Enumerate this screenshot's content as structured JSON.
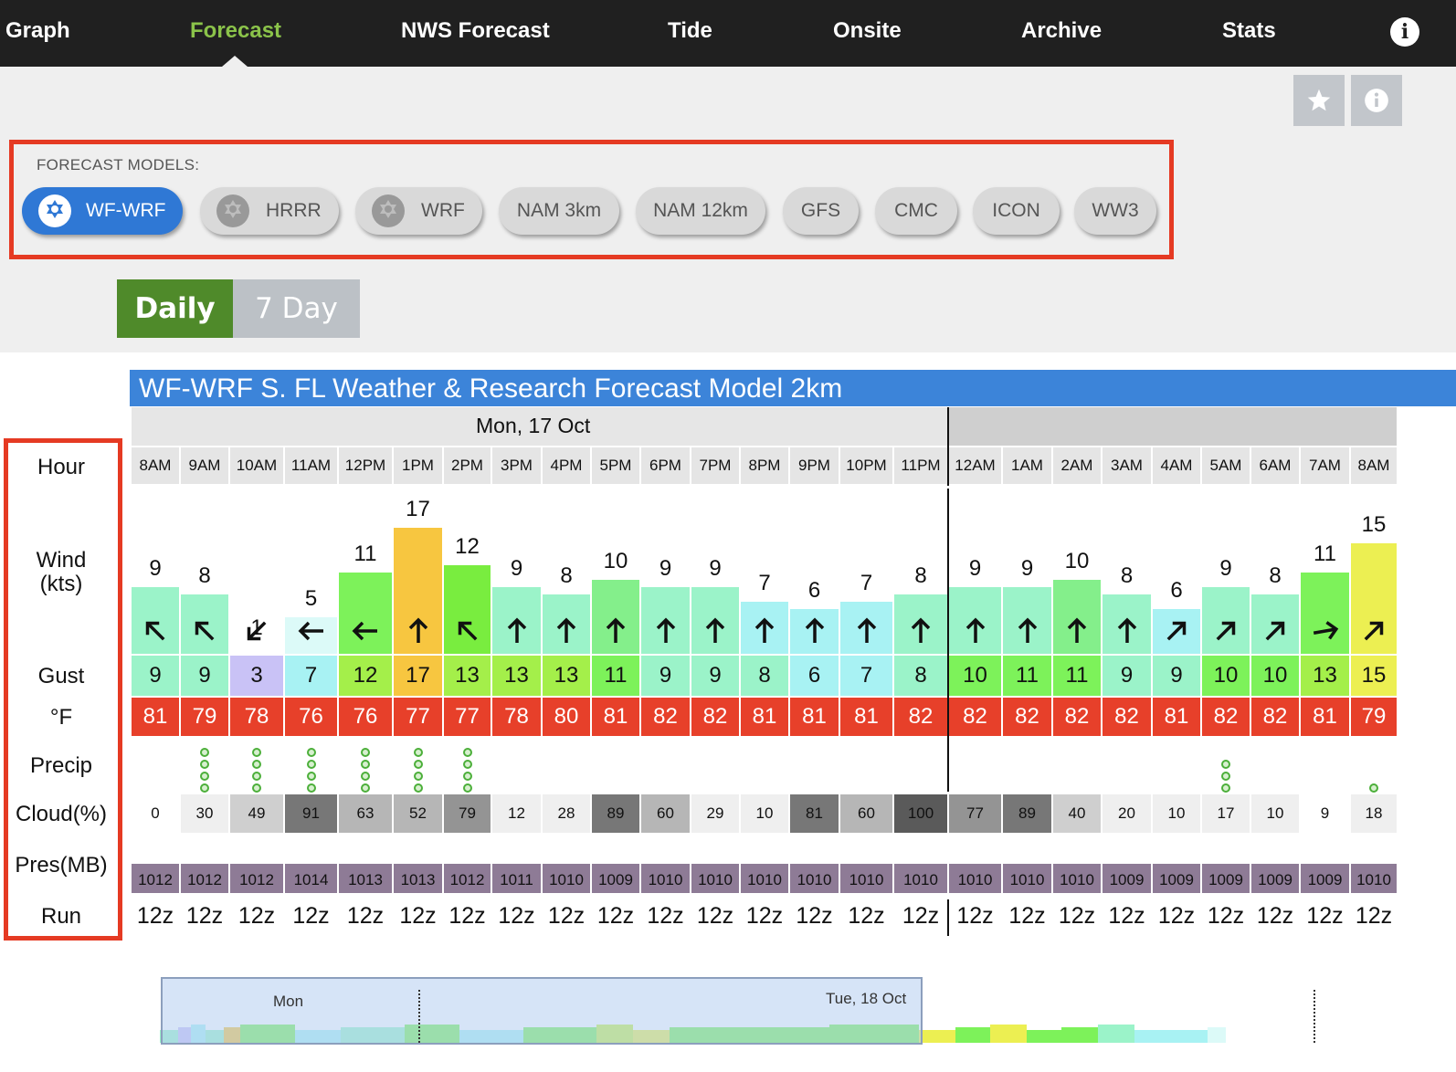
{
  "nav": {
    "items": [
      "Graph",
      "Forecast",
      "NWS Forecast",
      "Tide",
      "Onsite",
      "Archive",
      "Stats"
    ],
    "active": "Forecast"
  },
  "icons": {
    "favorite": "star-icon",
    "info": "info-icon",
    "model": "model-badge-icon"
  },
  "models": {
    "label": "FORECAST MODELS:",
    "items": [
      {
        "name": "WF-WRF",
        "active": true,
        "icon": true
      },
      {
        "name": "HRRR",
        "active": false,
        "icon": true
      },
      {
        "name": "WRF",
        "active": false,
        "icon": true
      },
      {
        "name": "NAM 3km",
        "active": false,
        "icon": false
      },
      {
        "name": "NAM 12km",
        "active": false,
        "icon": false
      },
      {
        "name": "GFS",
        "active": false,
        "icon": false
      },
      {
        "name": "CMC",
        "active": false,
        "icon": false
      },
      {
        "name": "ICON",
        "active": false,
        "icon": false
      },
      {
        "name": "WW3",
        "active": false,
        "icon": false
      }
    ]
  },
  "view_tabs": {
    "daily": "Daily",
    "seven_day": "7 Day",
    "active": "Daily"
  },
  "forecast": {
    "title": "WF-WRF S. FL Weather & Research Forecast Model 2km",
    "date_label": "Mon, 17 Oct",
    "row_labels": {
      "hour": "Hour",
      "wind_line1": "Wind",
      "wind_line2": "(kts)",
      "gust": "Gust",
      "temp": "°F",
      "precip": "Precip",
      "cloud": "Cloud(%)",
      "pressure": "Pres(MB)",
      "run": "Run"
    },
    "hours": [
      "8AM",
      "9AM",
      "10AM",
      "11AM",
      "12PM",
      "1PM",
      "2PM",
      "3PM",
      "4PM",
      "5PM",
      "6PM",
      "7PM",
      "8PM",
      "9PM",
      "10PM",
      "11PM",
      "12AM",
      "1AM",
      "2AM",
      "3AM",
      "4AM",
      "5AM",
      "6AM",
      "7AM",
      "8AM"
    ],
    "wind": [
      9,
      8,
      1,
      5,
      11,
      17,
      12,
      9,
      8,
      10,
      9,
      9,
      7,
      6,
      7,
      8,
      9,
      9,
      10,
      8,
      6,
      9,
      8,
      11,
      15
    ],
    "wind_direction": [
      "NW",
      "NW",
      "SW",
      "W",
      "W",
      "N",
      "NW",
      "N",
      "N",
      "N",
      "N",
      "N",
      "N",
      "N",
      "N",
      "N",
      "N",
      "N",
      "N",
      "N",
      "NE",
      "NE",
      "NE",
      "E",
      "NE"
    ],
    "gust": [
      9,
      9,
      3,
      7,
      12,
      17,
      13,
      13,
      13,
      11,
      9,
      9,
      8,
      6,
      7,
      8,
      10,
      11,
      11,
      9,
      9,
      10,
      10,
      13,
      15
    ],
    "temp_f": [
      81,
      79,
      78,
      76,
      76,
      77,
      77,
      78,
      80,
      81,
      82,
      82,
      81,
      81,
      81,
      82,
      82,
      82,
      82,
      82,
      81,
      82,
      82,
      81,
      79
    ],
    "precip_level": [
      0,
      4,
      4,
      4,
      4,
      4,
      4,
      0,
      0,
      0,
      0,
      0,
      0,
      0,
      0,
      0,
      0,
      0,
      0,
      0,
      0,
      3,
      0,
      0,
      1
    ],
    "cloud_pct": [
      0,
      30,
      49,
      91,
      63,
      52,
      79,
      12,
      28,
      89,
      60,
      29,
      10,
      81,
      60,
      100,
      77,
      89,
      40,
      20,
      10,
      17,
      10,
      9,
      18
    ],
    "pressure_mb": [
      1012,
      1012,
      1012,
      1014,
      1013,
      1013,
      1012,
      1011,
      1010,
      1009,
      1010,
      1010,
      1010,
      1010,
      1010,
      1010,
      1010,
      1010,
      1010,
      1009,
      1009,
      1009,
      1009,
      1009,
      1010
    ],
    "run": [
      "12z",
      "12z",
      "12z",
      "12z",
      "12z",
      "12z",
      "12z",
      "12z",
      "12z",
      "12z",
      "12z",
      "12z",
      "12z",
      "12z",
      "12z",
      "12z",
      "12z",
      "12z",
      "12z",
      "12z",
      "12z",
      "12z",
      "12z",
      "12z",
      "12z"
    ]
  },
  "mini_chart": {
    "left_label": "Mon",
    "right_label": "Tue, 18 Oct"
  }
}
